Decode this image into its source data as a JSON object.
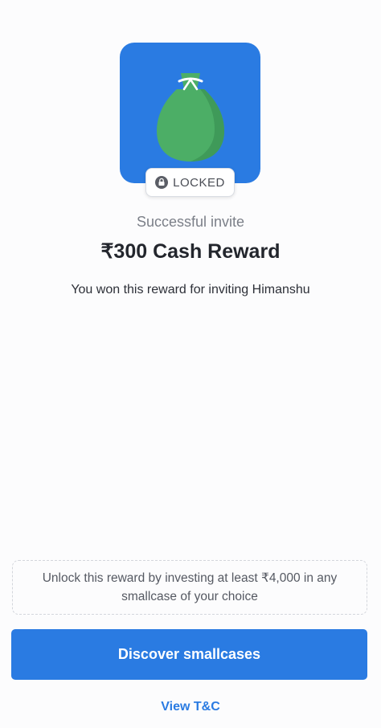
{
  "reward_card": {
    "icon": "money-bag-icon",
    "card_color": "#2a7be2",
    "bag_color": "#4cae66",
    "status_badge": "LOCKED",
    "status_icon": "lock-icon"
  },
  "reward": {
    "subtitle": "Successful invite",
    "title": "₹300 Cash Reward",
    "description": "You won this reward for inviting Himanshu"
  },
  "unlock_info": {
    "text": "Unlock this reward by investing at least ₹4,000 in any smallcase of your choice"
  },
  "actions": {
    "primary_label": "Discover smallcases",
    "secondary_label": "View T&C",
    "accent_color": "#2a7be2"
  }
}
